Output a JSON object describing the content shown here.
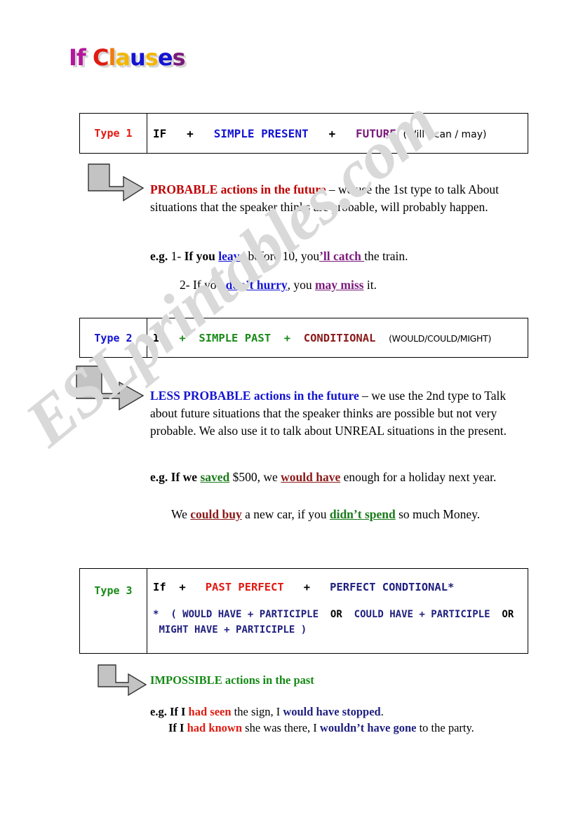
{
  "title": {
    "text": "If Clauses",
    "letters": [
      {
        "ch": "I",
        "color": "#b3179b"
      },
      {
        "ch": "f",
        "color": "#b3179b"
      },
      {
        "ch": " ",
        "color": "#000000"
      },
      {
        "ch": "C",
        "color": "#e01b12"
      },
      {
        "ch": "l",
        "color": "#ef7d10"
      },
      {
        "ch": "a",
        "color": "#f2b705"
      },
      {
        "ch": "u",
        "color": "#1414d2"
      },
      {
        "ch": "s",
        "color": "#f2b705"
      },
      {
        "ch": "e",
        "color": "#1414d2"
      },
      {
        "ch": "s",
        "color": "#7b1b7b"
      }
    ]
  },
  "watermark": {
    "text": "ESLprintables.com",
    "color": "#d9d9d9"
  },
  "type1": {
    "label": "Type 1",
    "label_color": "#e01b12",
    "formula": {
      "if": "IF",
      "plus1": "+",
      "tense": "SIMPLE PRESENT",
      "tense_color": "#1414d2",
      "plus2": "+",
      "result": "FUTURE",
      "result_color": "#7b1b7b",
      "note": "(Will / can / may)"
    },
    "heading": "PROBABLE  actions in the future",
    "heading_color": "#c00000",
    "body": " – we use the 1st type to talk About situations that the speaker thinks are probable, will probably happen.",
    "eg_label": "e.g.",
    "examples": [
      {
        "number": "1-",
        "pre": "If you ",
        "hl1": "leave",
        "mid": " before 10, you",
        "hl2": "’ll catch ",
        "post": "the train."
      },
      {
        "number": "2-",
        "pre": "If you ",
        "hl1": "don’t hurry",
        "mid": ", you ",
        "hl2": "may miss",
        "post": " it."
      }
    ]
  },
  "type2": {
    "label": "Type 2",
    "label_color": "#1414d2",
    "formula": {
      "if": "IF",
      "plus1": "+",
      "tense": "SIMPLE PAST",
      "tense_color": "#1a8a1a",
      "plus2": "+",
      "result": "CONDITIONAL",
      "result_color": "#8b1a1a",
      "note": "(WOULD/COULD/MIGHT)"
    },
    "heading": "LESS PROBABLE actions in the future",
    "heading_color": "#1414d2",
    "body": " – we use the 2nd type to Talk about future situations that the speaker thinks are possible but not very probable. We also use it to talk about UNREAL situations in the present.",
    "eg_label": "e.g.",
    "examples": [
      {
        "pre": " If we ",
        "hl1": "saved",
        "mid": " $500, we ",
        "hl2": "would have",
        "post": " enough for a holiday next year."
      },
      {
        "pre": "We ",
        "hl1": "could buy",
        "mid": " a new car, if you ",
        "hl2": "didn’t spend",
        "post": " so much Money."
      }
    ]
  },
  "type3": {
    "label": "Type 3",
    "label_color": "#1a8a1a",
    "formula": {
      "if": "If",
      "plus1": "+",
      "tense": "PAST PERFECT",
      "tense_color": "#e01b12",
      "plus2": "+",
      "result": "PERFECT CONDTIONAL*",
      "result_color": "#202080"
    },
    "footnote": {
      "star": "*",
      "part1": "( WOULD HAVE + PARTICIPLE",
      "or1": "OR",
      "part2": "COULD HAVE  +  PARTICIPLE",
      "or2": "OR",
      "part3": "MIGHT HAVE + PARTICIPLE )"
    },
    "heading": "IMPOSSIBLE actions in the past",
    "heading_color": "#158a15",
    "eg_label": "e.g.",
    "examples": [
      {
        "pre": "If I ",
        "hl1": "had seen",
        "mid": " the sign, I ",
        "hl2": "would have stopped",
        "post": "."
      },
      {
        "pre": "If I ",
        "hl1": "had known",
        "mid": " she was there, I ",
        "hl2": "wouldn’t have gone",
        "post": " to the party."
      }
    ]
  }
}
